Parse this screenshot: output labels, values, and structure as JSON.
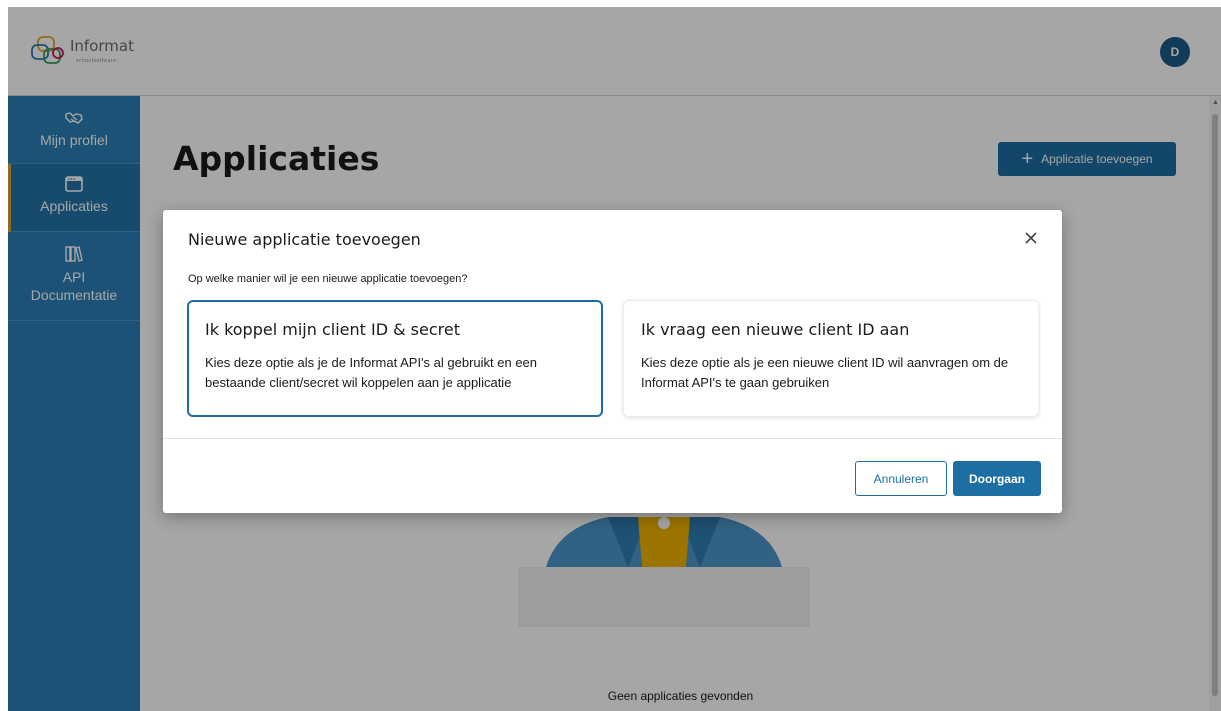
{
  "header": {
    "logo_text": "Informat",
    "logo_sub": "schoolsoftware",
    "avatar_initial": "D"
  },
  "sidebar": {
    "items": [
      {
        "label": "Mijn profiel",
        "icon": "handshake-icon"
      },
      {
        "label": "Applicaties",
        "icon": "browser-window-icon",
        "active": true
      },
      {
        "label": "API Documentatie",
        "icon": "books-icon"
      }
    ]
  },
  "main": {
    "title": "Applicaties",
    "add_button_label": "Applicatie toevoegen",
    "empty_text": "Geen applicaties gevonden"
  },
  "modal": {
    "title": "Nieuwe applicatie toevoegen",
    "question": "Op welke manier wil je een nieuwe applicatie toevoegen?",
    "options": [
      {
        "title": "Ik koppel mijn client ID & secret",
        "description": "Kies deze optie als je de Informat API's al gebruikt en een bestaande client/secret wil koppelen aan je applicatie",
        "selected": true
      },
      {
        "title": "Ik vraag een nieuwe client ID aan",
        "description": "Kies deze optie als je een nieuwe client ID wil aanvragen om de Informat API's te gaan gebruiken",
        "selected": false
      }
    ],
    "cancel_label": "Annuleren",
    "continue_label": "Doorgaan"
  },
  "colors": {
    "primary": "#1d6ea3",
    "sidebar": "#2a7fb6",
    "active_indicator": "#e2a23b"
  }
}
